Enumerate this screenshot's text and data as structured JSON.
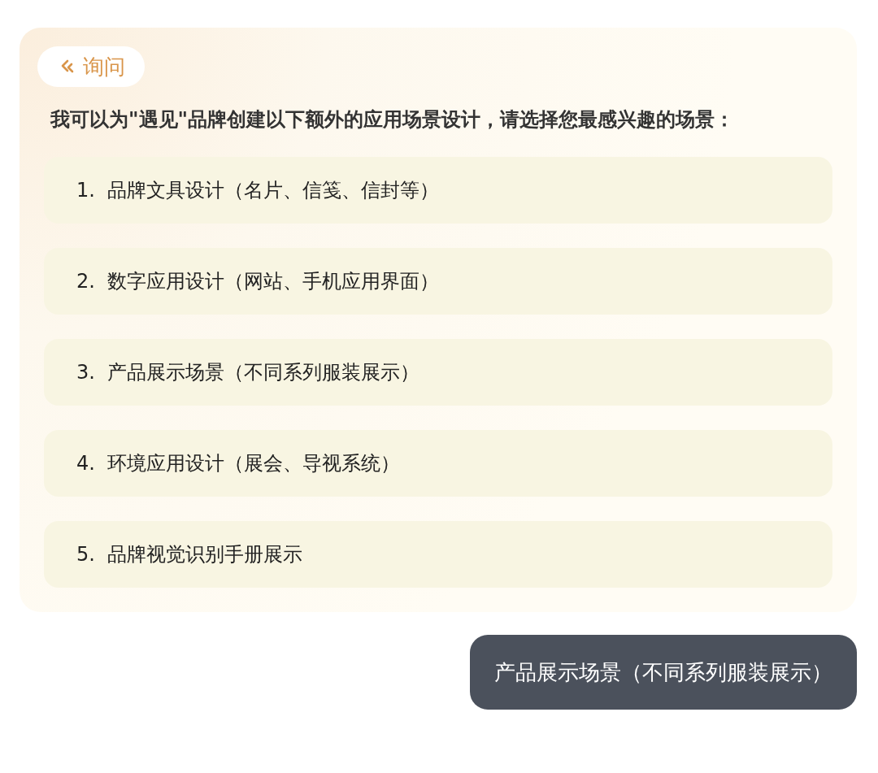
{
  "badge": {
    "label": "询问"
  },
  "question": "我可以为\"遇见\"品牌创建以下额外的应用场景设计，请选择您最感兴趣的场景：",
  "options": [
    {
      "label": "1.  品牌文具设计（名片、信笺、信封等）"
    },
    {
      "label": "2.  数字应用设计（网站、手机应用界面）"
    },
    {
      "label": "3.  产品展示场景（不同系列服装展示）"
    },
    {
      "label": "4.  环境应用设计（展会、导视系统）"
    },
    {
      "label": "5.  品牌视觉识别手册展示"
    }
  ],
  "reply": "产品展示场景（不同系列服装展示）"
}
